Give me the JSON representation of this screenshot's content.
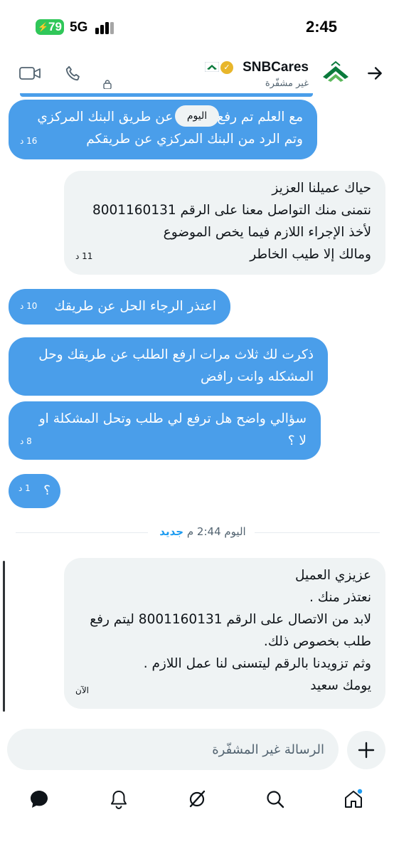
{
  "status": {
    "battery": "79",
    "network": "5G",
    "time": "2:45"
  },
  "header": {
    "account_name": "SNBCares",
    "encryption_status": "غير مشفّرة"
  },
  "conversation": {
    "today_label": "اليوم",
    "messages": [
      {
        "side": "sent",
        "lines": [
          "مع العلم تم رفع الطلب عن طريق البنك المركزي",
          "وتم الرد من البنك المركزي عن طريقكم"
        ],
        "time": "16 د"
      },
      {
        "side": "received",
        "lines": [
          "حياك عميلنا العزيز",
          "نتمنى منك التواصل معنا على الرقم 8001160131",
          "لأخذ الإجراء اللازم فيما يخص الموضوع",
          "ومالك إلا طيب الخاطر"
        ],
        "time": "11 د"
      },
      {
        "side": "sent",
        "lines": [
          "اعتذر الرجاء الحل عن طريقك"
        ],
        "time": "10 د"
      },
      {
        "side": "sent",
        "lines": [
          "ذكرت لك ثلاث مرات ارفع الطلب عن طريقك وحل",
          "المشكله وانت رافض"
        ],
        "time": ""
      },
      {
        "side": "sent",
        "lines": [
          "سؤالي واضح هل ترفع لي طلب وتحل المشكلة او",
          "لا ؟"
        ],
        "time": "8 د"
      },
      {
        "side": "sent",
        "lines": [
          "؟"
        ],
        "time": "1 د"
      },
      {
        "side": "received",
        "lines": [
          "عزيزي العميل",
          "نعتذر منك .",
          "لابد من الاتصال على الرقم 8001160131 ليتم رفع",
          "طلب بخصوص ذلك.",
          "وثم تزويدنا بالرقم ليتسنى لنا عمل اللازم .",
          "يومك سعيد"
        ],
        "time": "الآن"
      }
    ],
    "divider": {
      "date_text": "اليوم 2:44 م",
      "new_label": "جديد"
    }
  },
  "composer": {
    "placeholder": "الرسالة غير المشفّرة"
  },
  "colors": {
    "sent_bubble": "#4a9eea",
    "received_bubble": "#eff3f4",
    "accent": "#1d9bf0",
    "battery": "#30c759",
    "logo_green": "#0a7a3c"
  },
  "nav": {
    "icons": [
      "messages-icon",
      "notifications-icon",
      "grok-icon",
      "search-icon",
      "home-icon"
    ]
  }
}
